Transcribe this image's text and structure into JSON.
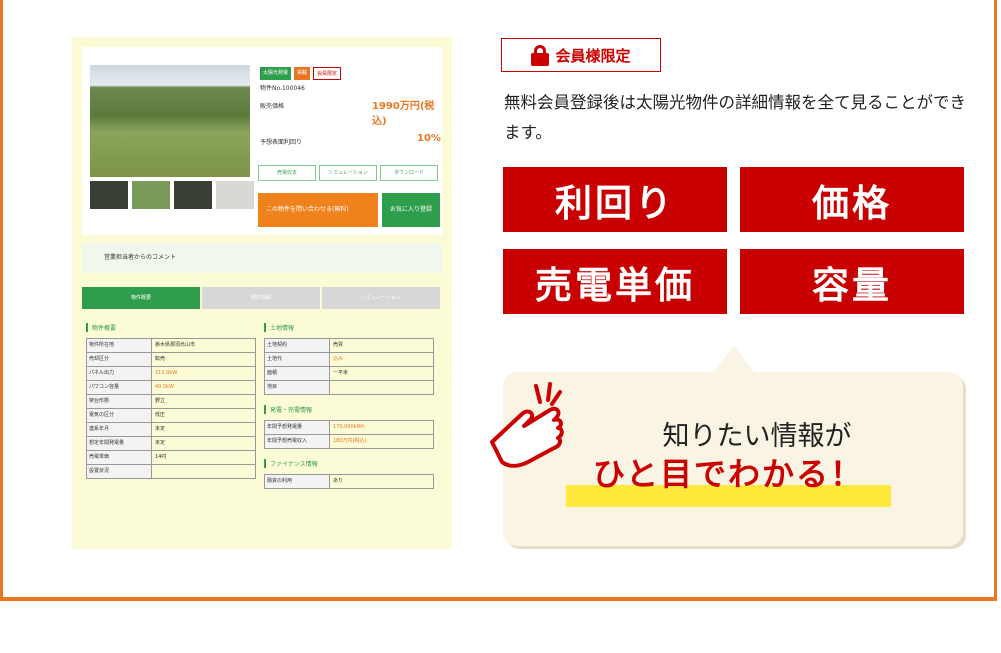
{
  "preview": {
    "tags": [
      "太陽光発電",
      "掲載",
      "会員限定"
    ],
    "property_no": "物件No.100046",
    "price_label": "販売価格",
    "price_value": "1990万円(税込)",
    "yield_label": "予想表面利回り",
    "yield_value": "10%",
    "sub_buttons": [
      "売電収支",
      "シミュレーション",
      "ダウンロード"
    ],
    "inquiry_button": "この物件を問い合わせる(無料)",
    "favorite_button": "お気に入り登録",
    "comment_label": "営業担当者からのコメント",
    "tabs": [
      "物件概要",
      "周辺地図",
      "シミュレーション"
    ],
    "left_table": {
      "title": "物件概要",
      "rows": [
        {
          "k": "物件所在地",
          "v": "栃木県那須烏山市"
        },
        {
          "k": "売却区分",
          "v": "転売"
        },
        {
          "k": "パネル出力",
          "v": "111.9kW"
        },
        {
          "k": "パワコン容量",
          "v": "49.5kW"
        },
        {
          "k": "架台形態",
          "v": "野立"
        },
        {
          "k": "電気の区分",
          "v": "低圧"
        },
        {
          "k": "連系年月",
          "v": "未定"
        },
        {
          "k": "想定年間発電量",
          "v": "未定"
        },
        {
          "k": "売電単価",
          "v": "14円"
        },
        {
          "k": "設置状況",
          "v": ""
        }
      ]
    },
    "right_table": {
      "title": "土地情報",
      "rows": [
        {
          "k": "土地契約",
          "v": "売買"
        },
        {
          "k": "土地代",
          "v": "込み"
        },
        {
          "k": "面積",
          "v": "ー平米"
        },
        {
          "k": "地目",
          "v": ""
        }
      ],
      "title2": "発電・売電情報",
      "rows2": [
        {
          "k": "年間予想発電量",
          "v": "170,000kWh"
        },
        {
          "k": "年間予想売電収入",
          "v": "180万円(税込)"
        }
      ],
      "title3": "ファイナンス情報",
      "rows3": [
        {
          "k": "融資の利用",
          "v": "あり"
        }
      ]
    }
  },
  "badge": {
    "text": "会員様限定",
    "icon": "lock-icon",
    "color": "#cc0000"
  },
  "description": "無料会員登録後は太陽光物件の詳細情報を全て見ることができます。",
  "features": [
    "利回り",
    "価格",
    "売電単価",
    "容量"
  ],
  "callout": {
    "line1": "知りたい情報が",
    "line2": "ひと目でわかる！",
    "icon": "tap-hand-icon",
    "highlight_color": "#ffe93a"
  },
  "colors": {
    "accent": "#e87722",
    "red": "#c80000",
    "green": "#2e9d4c"
  }
}
